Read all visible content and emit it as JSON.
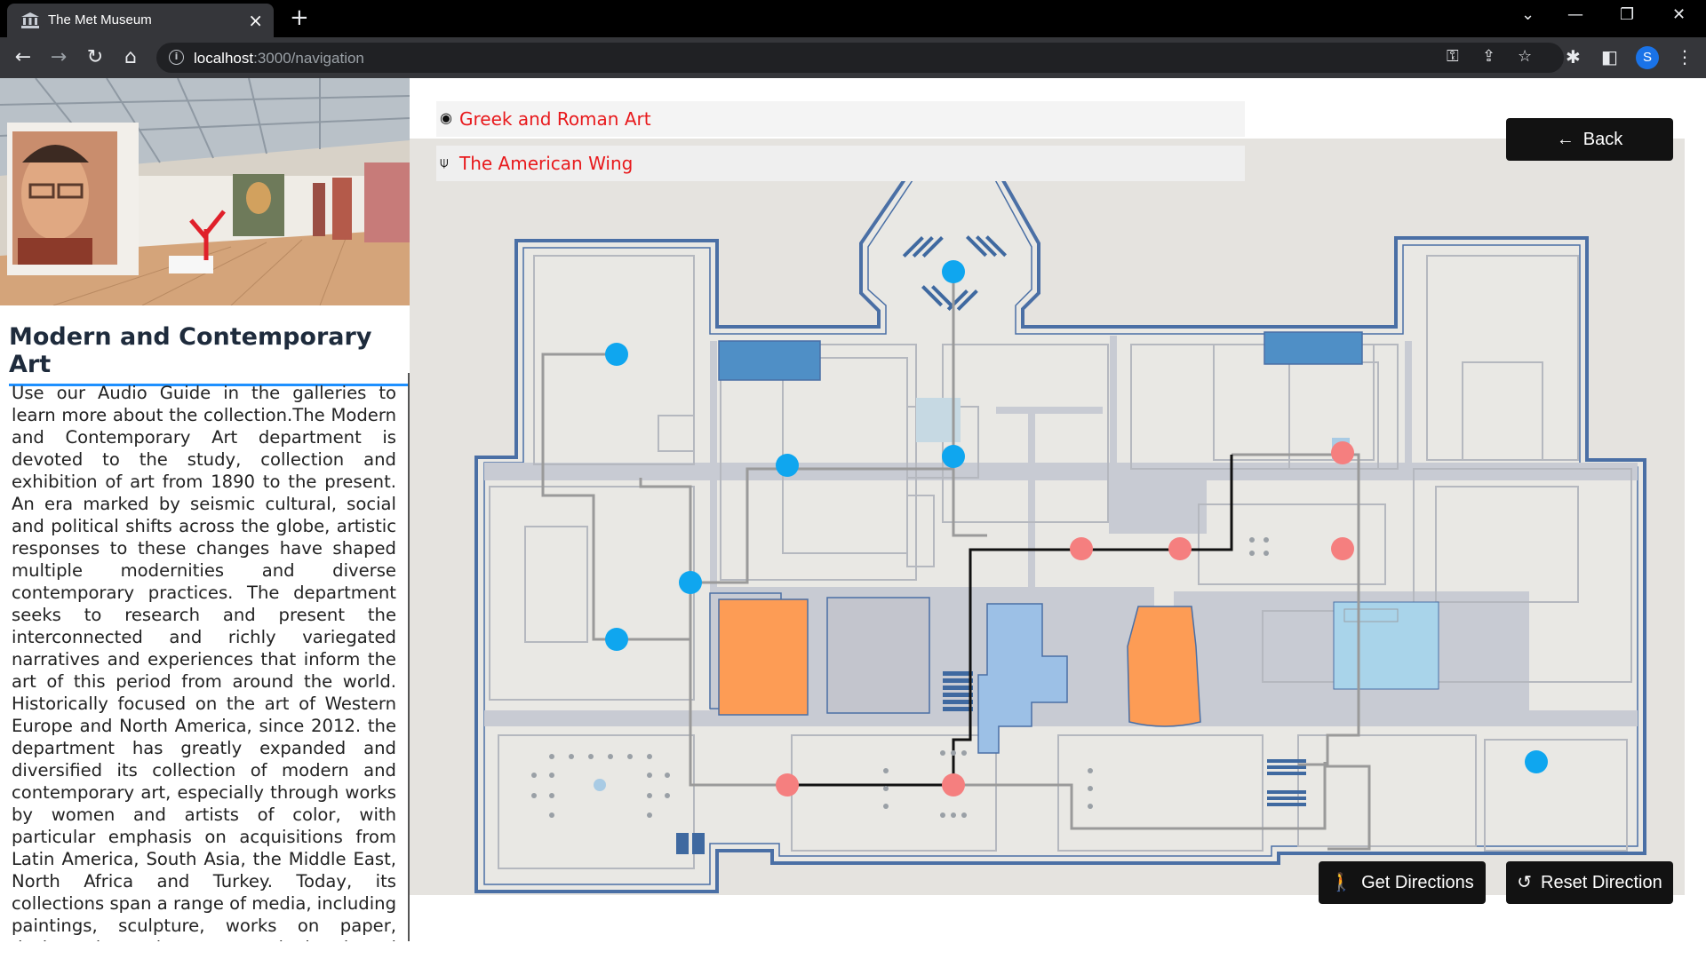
{
  "browser": {
    "tab_title": "The Met Museum",
    "url_host": "localhost",
    "url_path": ":3000/navigation"
  },
  "left_panel": {
    "title": "Modern and Contemporary Art",
    "description": "Use our Audio Guide in the galleries to learn more about the collection.The Modern and Contemporary Art department is devoted to the study, collection and exhibition of art from 1890 to the present. An era marked by seismic cultural, social and political shifts across the globe, artistic responses to these changes have shaped multiple modernities and diverse contemporary practices. The department seeks to research and present the interconnected and richly variegated narratives and experiences that inform the art of this period from around the world. Historically focused on the art of Western Europe and North America, since 2012. the department has greatly expanded and diversified its collection of modern and contemporary art, especially through works by women and artists of color, with particular emphasis on acquisitions from Latin America, South Asia, the Middle East, North Africa and Turkey. Today, its collections span a range of media, including paintings, sculpture, works on paper, design, decorative arts, and time-based media. The department presents rotating selections"
  },
  "navigation": {
    "from_location": "Greek and Roman Art",
    "to_location": "The American Wing",
    "back_label": "Back",
    "get_directions_label": "Get Directions",
    "reset_direction_label": "Reset Direction"
  },
  "map": {
    "colors": {
      "wall": "#4a6fa5",
      "corridor": "#c8cbd3",
      "floor": "#e9e8e4",
      "node_blue": "#0fa6ef",
      "node_red": "#f57f7f",
      "route": "#111111",
      "path": "#9a9a9a",
      "orange": "#fd9c55",
      "dark_blue": "#4f8fc6",
      "light_blue": "#9cc0e6"
    },
    "route_nodes": [
      "red-node-1",
      "red-node-2",
      "red-node-3",
      "red-node-4",
      "red-node-5",
      "red-node-6"
    ]
  }
}
